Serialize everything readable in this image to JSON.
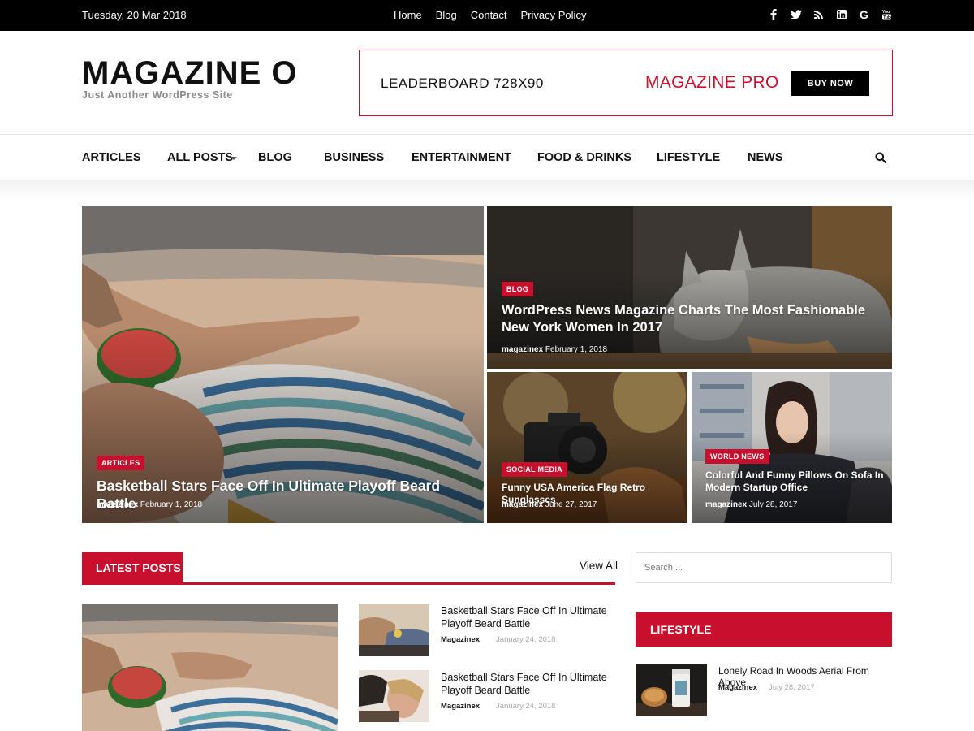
{
  "topbar": {
    "date": "Tuesday, 20 Mar 2018",
    "links": [
      "Home",
      "Blog",
      "Contact",
      "Privacy Policy"
    ],
    "social_icons": [
      "facebook-icon",
      "twitter-icon",
      "rss-icon",
      "linkedin-icon",
      "google-icon",
      "youtube-icon"
    ]
  },
  "header": {
    "logo": "MAGAZINE O",
    "tagline": "Just Another WordPress Site",
    "ad": {
      "label": "LEADERBOARD 728X90",
      "brand": "MAGAZINE PRO",
      "button": "BUY NOW"
    }
  },
  "nav": {
    "items": [
      "ARTICLES",
      "ALL POSTS",
      "BLOG",
      "BUSINESS",
      "ENTERTAINMENT",
      "FOOD & DRINKS",
      "LIFESTYLE",
      "NEWS"
    ]
  },
  "hero": {
    "main": {
      "tag": "ARTICLES",
      "title": "Basketball Stars Face Off In Ultimate Playoff Beard Battle",
      "author": "magazinex",
      "date": "February 1, 2018"
    },
    "top_right": {
      "tag": "BLOG",
      "title": "WordPress News Magazine Charts The Most Fashionable New York Women In 2017",
      "author": "magazinex",
      "date": "February 1, 2018"
    },
    "bottom_left": {
      "tag": "SOCIAL MEDIA",
      "title": "Funny USA America Flag Retro Sunglasses",
      "author": "magazinex",
      "date": "June 27, 2017"
    },
    "bottom_right": {
      "tag": "WORLD NEWS",
      "title": "Colorful And Funny Pillows On Sofa In Modern Startup Office",
      "author": "magazinex",
      "date": "July 28, 2017"
    }
  },
  "latest": {
    "heading": "LATEST POSTS",
    "view_all": "View All",
    "items": [
      {
        "title": "Basketball Stars Face Off In Ultimate Playoff Beard Battle",
        "author": "Magazinex",
        "date": "January 24, 2018"
      },
      {
        "title": "Basketball Stars Face Off In Ultimate Playoff Beard Battle",
        "author": "Magazinex",
        "date": "January 24, 2018"
      }
    ]
  },
  "sidebar": {
    "search_placeholder": "Search ...",
    "heading": "LIFESTYLE",
    "item": {
      "title": "Lonely Road In Woods Aerial From Above",
      "author": "Magazinex",
      "date": "July 28, 2017"
    }
  }
}
